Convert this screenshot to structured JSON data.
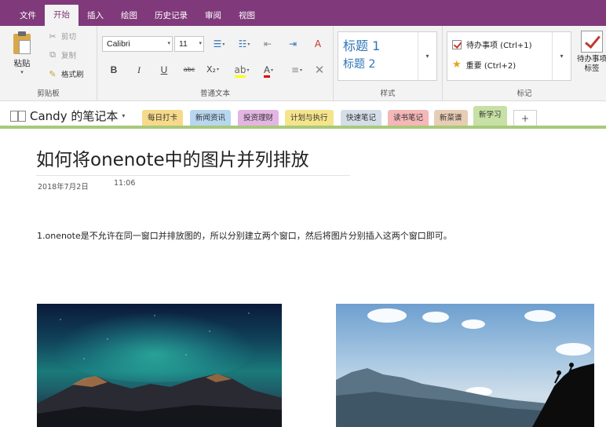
{
  "menu": {
    "tabs": [
      {
        "label": "文件"
      },
      {
        "label": "开始"
      },
      {
        "label": "插入"
      },
      {
        "label": "绘图"
      },
      {
        "label": "历史记录"
      },
      {
        "label": "审阅"
      },
      {
        "label": "视图"
      }
    ],
    "active_tab": "开始",
    "accent_color": "#80397b"
  },
  "ribbon": {
    "clipboard": {
      "paste_label": "粘贴",
      "cut_label": "剪切",
      "copy_label": "复制",
      "format_painter_label": "格式刷",
      "group_label": "剪贴板"
    },
    "text": {
      "font_name": "Calibri",
      "font_size": "11",
      "bold": "B",
      "italic": "I",
      "underline": "U",
      "strike": "abc",
      "subscript": "X₂",
      "font_color": "A",
      "group_label": "普通文本"
    },
    "styles": {
      "heading1": "标题 1",
      "heading2": "标题 2",
      "group_label": "样式"
    },
    "tags": {
      "todo": "待办事项 (Ctrl+1)",
      "important": "重要 (Ctrl+2)",
      "todo_tag_line1": "待办事项",
      "todo_tag_line2": "标签",
      "group_label": "标记"
    }
  },
  "notebook": {
    "name": "Candy 的笔记本",
    "sections": [
      {
        "label": "每日打卡",
        "color": "#f7d98b"
      },
      {
        "label": "新闻资讯",
        "color": "#b7d7f0"
      },
      {
        "label": "投资理财",
        "color": "#e3b5e3"
      },
      {
        "label": "计划与执行",
        "color": "#f5e48b"
      },
      {
        "label": "快速笔记",
        "color": "#d4dde8"
      },
      {
        "label": "读书笔记",
        "color": "#f5b7b7"
      },
      {
        "label": "新菜谱",
        "color": "#e8cdb5"
      },
      {
        "label": "新学习",
        "color": "#c6e0a5"
      }
    ],
    "active_section": "新学习",
    "add_label": "+"
  },
  "page": {
    "title": "如何将onenote中的图片并列排放",
    "date": "2018年7月2日",
    "time": "11:06",
    "body": "1.onenote是不允许在同一窗口并排放图的，所以分别建立两个窗口，然后将图片分别插入这两个窗口即可。"
  }
}
